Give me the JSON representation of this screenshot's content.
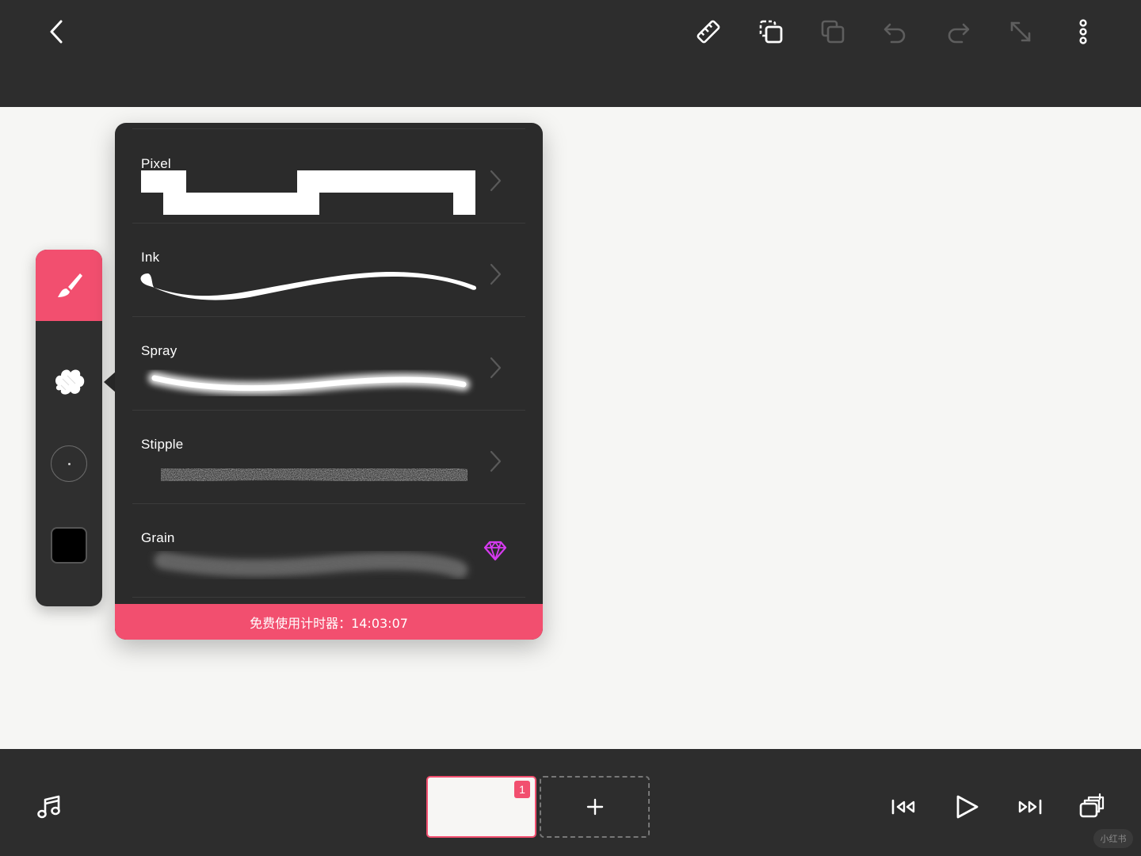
{
  "accent_color": "#f24f6f",
  "premium_color": "#d63af0",
  "toolbar": {
    "back_icon": "chevron-left-icon",
    "icons": [
      "ruler-icon",
      "copy-to-layer-icon",
      "duplicate-icon",
      "undo-icon",
      "redo-icon",
      "expand-icon",
      "more-vertical-icon"
    ]
  },
  "tools": {
    "brush_icon": "paintbrush-icon",
    "texture_icon": "brush-texture-icon",
    "size_icon": "brush-size-icon",
    "color_value": "#000000"
  },
  "brushes": [
    {
      "name": "Pixel",
      "premium": false
    },
    {
      "name": "Ink",
      "premium": false
    },
    {
      "name": "Spray",
      "premium": false
    },
    {
      "name": "Stipple",
      "premium": false
    },
    {
      "name": "Grain",
      "premium": true
    }
  ],
  "timer": {
    "text": "免费使用计时器：14:03:07"
  },
  "frames": {
    "current_badge": "1",
    "add_label": "+"
  },
  "playback": {
    "icons": [
      "first-frame-icon",
      "play-icon",
      "last-frame-icon",
      "onion-skin-icon"
    ]
  },
  "music_icon": "music-note-icon",
  "watermark": "小红书"
}
